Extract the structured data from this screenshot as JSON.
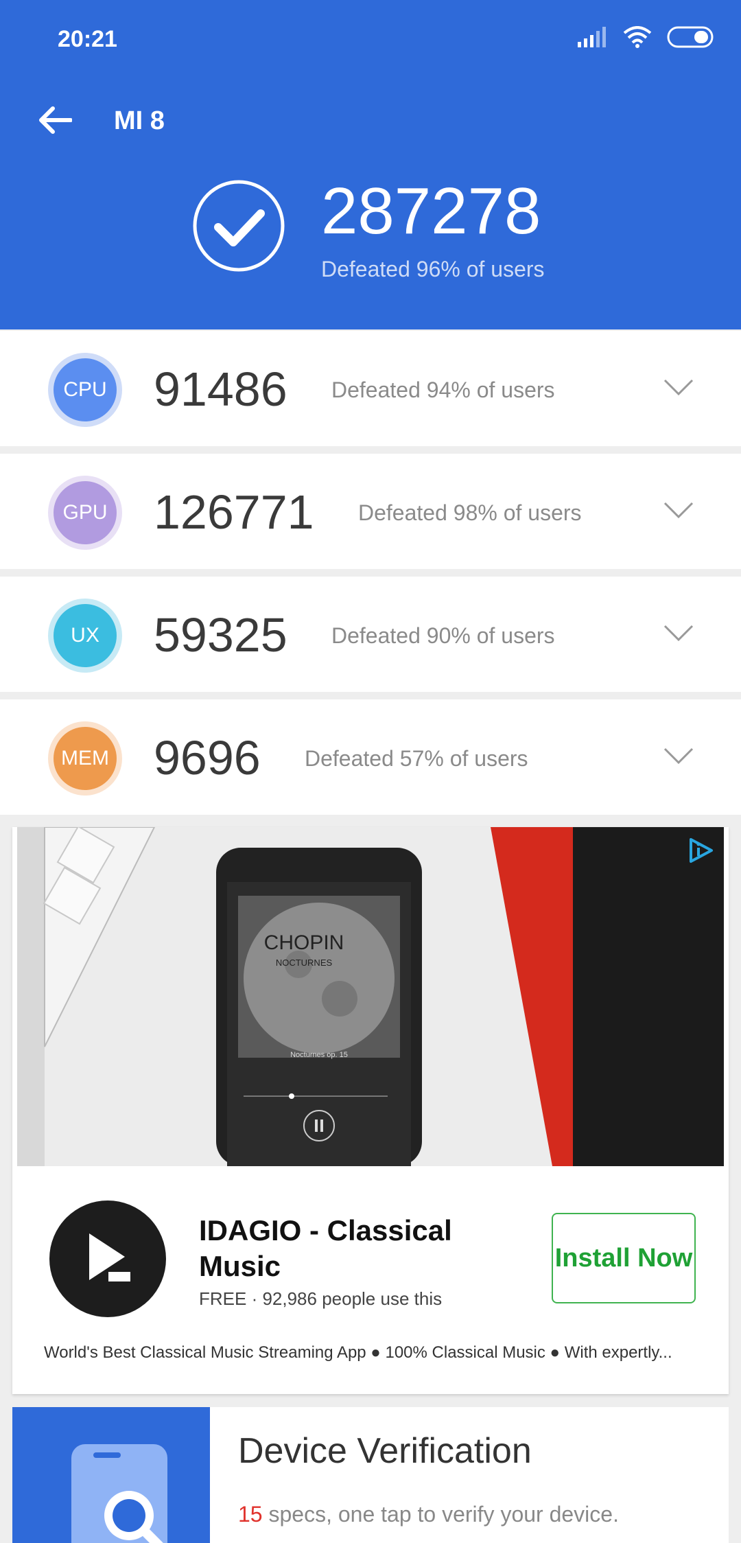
{
  "status_bar": {
    "time": "20:21",
    "icons": [
      "signal-icon",
      "wifi-icon",
      "battery-icon"
    ]
  },
  "header": {
    "title": "MI 8",
    "total_score": "287278",
    "total_defeated": "Defeated 96% of users",
    "background_color": "#2f6ad9"
  },
  "scores": [
    {
      "label": "CPU",
      "score": "91486",
      "defeated": "Defeated 94% of users",
      "color": "#5b8ef0"
    },
    {
      "label": "GPU",
      "score": "126771",
      "defeated": "Defeated 98% of users",
      "color": "#b19be0"
    },
    {
      "label": "UX",
      "score": "59325",
      "defeated": "Defeated 90% of users",
      "color": "#3bbde0"
    },
    {
      "label": "MEM",
      "score": "9696",
      "defeated": "Defeated 57% of users",
      "color": "#ee9a4d"
    }
  ],
  "ad": {
    "image_text": {
      "album": "CHOPIN",
      "subtitle": "NOCTURNES",
      "track": "Nocturnes op. 15"
    },
    "app_name": "IDAGIO - Classical Music",
    "meta": "FREE · 92,986 people use this",
    "install_label": "Install Now",
    "tagline": "World's Best Classical Music Streaming App  ●  100% Classical Music ●  With expertly...",
    "accent_color": "#1fa135"
  },
  "verification": {
    "title": "Device Verification",
    "count": "15",
    "description": " specs, one tap to verify your device."
  }
}
